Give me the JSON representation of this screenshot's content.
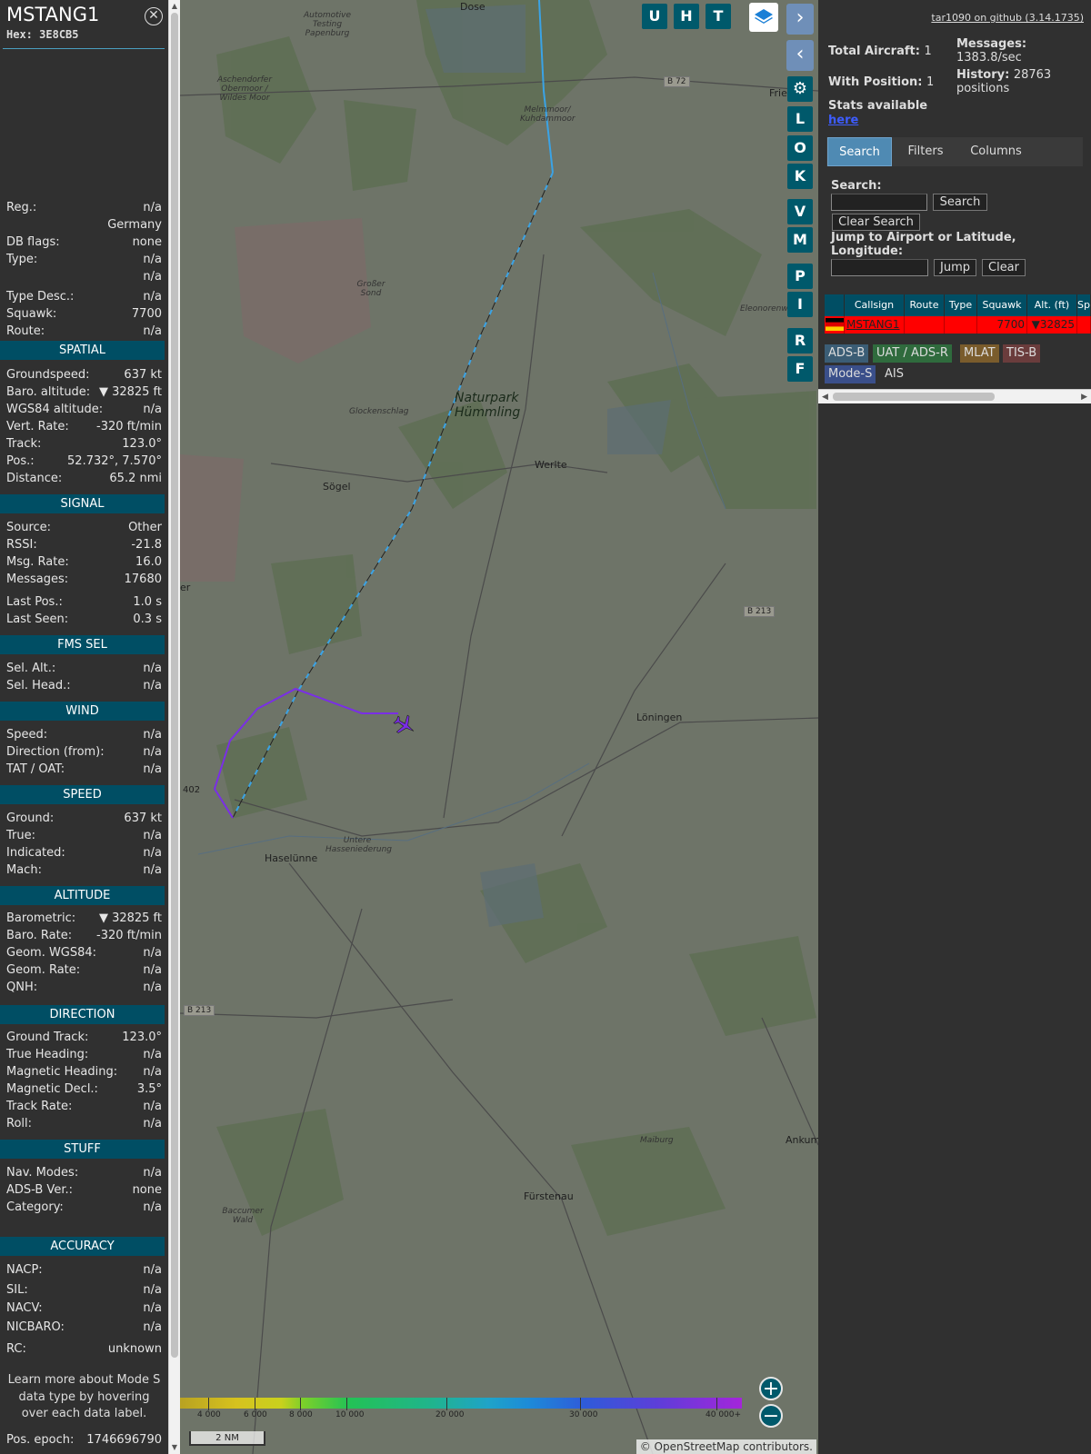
{
  "aircraft": {
    "callsign": "MSTANG1",
    "hex_label": "Hex:",
    "hex": "3E8CB5",
    "close_icon": "close-icon"
  },
  "info_rows": [
    {
      "k": "Reg.:",
      "v": "n/a"
    },
    {
      "k": "",
      "v": "Germany"
    },
    {
      "k": "DB flags:",
      "v": "none"
    },
    {
      "k": "Type:",
      "v": "n/a"
    },
    {
      "k": "",
      "v": "n/a"
    },
    {
      "k": "Type Desc.:",
      "v": "n/a"
    },
    {
      "k": "Squawk:",
      "v": "7700"
    },
    {
      "k": "Route:",
      "v": "n/a"
    }
  ],
  "sections": {
    "spatial": {
      "title": "SPATIAL",
      "rows": [
        {
          "k": "Groundspeed:",
          "v": "637 kt"
        },
        {
          "k": "Baro. altitude:",
          "v": "▼ 32825 ft"
        },
        {
          "k": "WGS84 altitude:",
          "v": "n/a"
        },
        {
          "k": "Vert. Rate:",
          "v": "-320 ft/min"
        },
        {
          "k": "Track:",
          "v": "123.0°"
        },
        {
          "k": "Pos.:",
          "v": "52.732°, 7.570°"
        },
        {
          "k": "Distance:",
          "v": "65.2 nmi"
        }
      ]
    },
    "signal": {
      "title": "SIGNAL",
      "rows": [
        {
          "k": "Source:",
          "v": "Other"
        },
        {
          "k": "RSSI:",
          "v": "-21.8"
        },
        {
          "k": "Msg. Rate:",
          "v": "16.0"
        },
        {
          "k": "Messages:",
          "v": "17680"
        },
        {
          "k": "Last Pos.:",
          "v": "1.0 s"
        },
        {
          "k": "Last Seen:",
          "v": "0.3 s"
        }
      ]
    },
    "fms": {
      "title": "FMS SEL",
      "rows": [
        {
          "k": "Sel. Alt.:",
          "v": "n/a"
        },
        {
          "k": "Sel. Head.:",
          "v": "n/a"
        }
      ]
    },
    "wind": {
      "title": "WIND",
      "rows": [
        {
          "k": "Speed:",
          "v": "n/a"
        },
        {
          "k": "Direction (from):",
          "v": "n/a"
        },
        {
          "k": "TAT / OAT:",
          "v": "n/a"
        }
      ]
    },
    "speed": {
      "title": "SPEED",
      "rows": [
        {
          "k": "Ground:",
          "v": "637 kt"
        },
        {
          "k": "True:",
          "v": "n/a"
        },
        {
          "k": "Indicated:",
          "v": "n/a"
        },
        {
          "k": "Mach:",
          "v": "n/a"
        }
      ]
    },
    "altitude": {
      "title": "ALTITUDE",
      "rows": [
        {
          "k": "Barometric:",
          "v": "▼ 32825 ft"
        },
        {
          "k": "Baro. Rate:",
          "v": "-320 ft/min"
        },
        {
          "k": "Geom. WGS84:",
          "v": "n/a"
        },
        {
          "k": "Geom. Rate:",
          "v": "n/a"
        },
        {
          "k": "QNH:",
          "v": "n/a"
        }
      ]
    },
    "direction": {
      "title": "DIRECTION",
      "rows": [
        {
          "k": "Ground Track:",
          "v": "123.0°"
        },
        {
          "k": "True Heading:",
          "v": "n/a"
        },
        {
          "k": "Magnetic Heading:",
          "v": "n/a"
        },
        {
          "k": "Magnetic Decl.:",
          "v": "3.5°"
        },
        {
          "k": "Track Rate:",
          "v": "n/a"
        },
        {
          "k": "Roll:",
          "v": "n/a"
        }
      ]
    },
    "stuff": {
      "title": "STUFF",
      "rows": [
        {
          "k": "Nav. Modes:",
          "v": "n/a"
        },
        {
          "k": "ADS-B Ver.:",
          "v": "none"
        },
        {
          "k": "Category:",
          "v": "n/a"
        }
      ]
    },
    "accuracy": {
      "title": "ACCURACY",
      "rows": [
        {
          "k": "NACP:",
          "v": "n/a"
        },
        {
          "k": "SIL:",
          "v": "n/a"
        },
        {
          "k": "NACV:",
          "v": "n/a"
        },
        {
          "k": "NICBARO:",
          "v": "n/a"
        },
        {
          "k": "RC:",
          "v": "unknown"
        }
      ]
    }
  },
  "help_text": "Learn more about Mode S data type by hovering over each data label.",
  "pos_epoch": {
    "k": "Pos. epoch:",
    "v": "1746696790"
  },
  "map": {
    "labels": {
      "dose": "Dose",
      "testing": "Automotive Testing Papenburg",
      "aschendorfer": "Aschendorfer Obermoor / Wildes Moor",
      "melmmoor": "Melmmoor/ Kuhdammoor",
      "frie": "Fries",
      "grosser": "Großer Sond",
      "eleonoren": "Eleonorenwald",
      "naturpark": "Naturpark Hümmling",
      "glocken": "Glockenschlag",
      "werlte": "Werlte",
      "sogel": "Sögel",
      "er": "er",
      "loningen": "Löningen",
      "haselunne": "Haselünne",
      "untere": "Untere Hasseniederung",
      "maiburg": "Maiburg",
      "ankum": "Ankum",
      "furstenau": "Fürstenau",
      "baccumer": "Baccumer Wald",
      "n402": "402"
    },
    "roads": {
      "b72": "B 72",
      "b213a": "B 213",
      "b213b": "B 213"
    },
    "buttons": {
      "u": "U",
      "h": "H",
      "t": "T",
      "l": "L",
      "o": "O",
      "k": "K",
      "v": "V",
      "m": "M",
      "p": "P",
      "i": "I",
      "r": "R",
      "f": "F"
    },
    "altitude_legend": [
      "4 000",
      "6 000",
      "8 000",
      "10 000",
      "20 000",
      "30 000",
      "40 000+"
    ],
    "scale": "2 NM",
    "attribution_prefix": "© ",
    "attribution_link": "OpenStreetMap",
    "attribution_suffix": " contributors.",
    "icons": {
      "layers": "layers-icon",
      "settings": "gear-icon",
      "zoom_in": "plus-icon",
      "zoom_out": "minus-icon",
      "aircraft": "aircraft-icon"
    }
  },
  "right": {
    "github": "tar1090 on github (3.14.1735)",
    "total_label": "Total Aircraft:",
    "total": "1",
    "messages_label": "Messages:",
    "messages": "1383.8/sec",
    "position_label": "With Position:",
    "position": "1",
    "history_label": "History:",
    "history": "28763 positions",
    "stats_label": "Stats available",
    "stats_link": "here",
    "tabs": [
      "Search",
      "Filters",
      "Columns"
    ],
    "search_label": "Search:",
    "search_button": "Search",
    "clear_search_button": "Clear Search",
    "jump_label": "Jump to Airport or Latitude, Longitude:",
    "jump_button": "Jump",
    "clear_button": "Clear",
    "table": {
      "headers": [
        "Callsign",
        "Route",
        "Type",
        "Squawk",
        "Alt. (ft)",
        "Sp"
      ],
      "row": {
        "callsign": "MSTANG1",
        "route": "",
        "type": "",
        "squawk": "7700",
        "alt": "▼32825"
      }
    },
    "sources": [
      "ADS-B",
      "UAT / ADS-R",
      "MLAT",
      "TIS-B",
      "Mode-S",
      "AIS"
    ],
    "colors": {
      "ads_b": "#3b5d75",
      "uat": "#2f6b3d",
      "mlat": "#7a5c2c",
      "tisb": "#6a3c3c",
      "modes": "#3a4f8a",
      "emergency": "#ff0000",
      "header": "#004e64"
    }
  }
}
